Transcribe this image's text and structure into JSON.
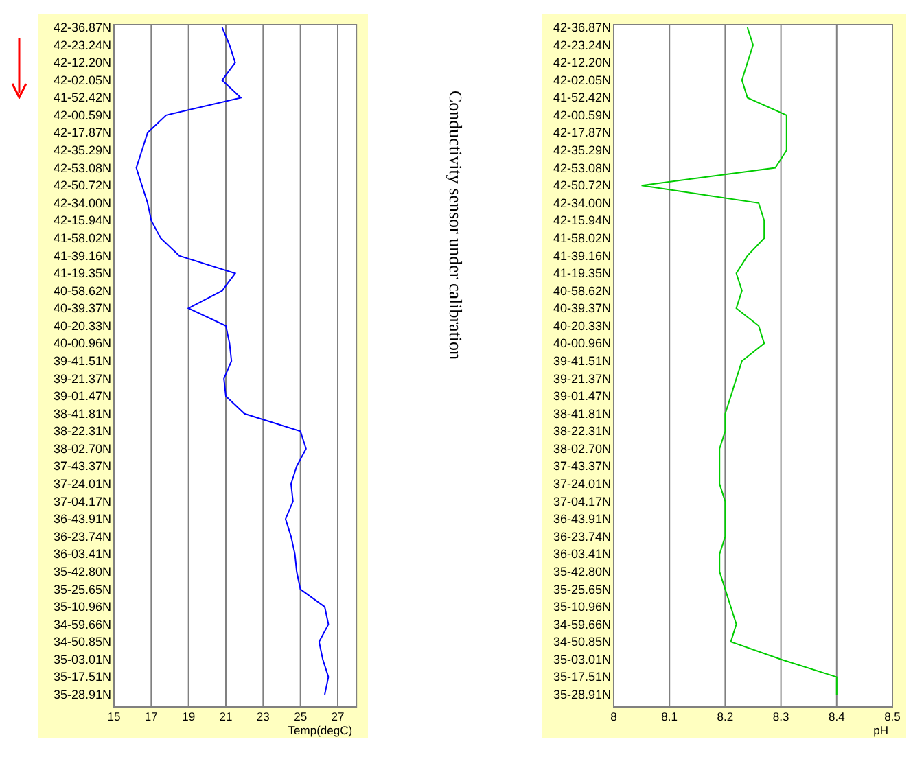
{
  "charts": [
    {
      "chart_data": {
        "type": "line",
        "orientation": "horizontal",
        "xlabel": "Temp(degC)",
        "grid": true,
        "xlim": [
          15,
          28
        ],
        "xticks": [
          15,
          17,
          19,
          21,
          23,
          25,
          27
        ],
        "categories": [
          "42-36.87N",
          "42-23.24N",
          "42-12.20N",
          "42-02.05N",
          "41-52.42N",
          "42-00.59N",
          "42-17.87N",
          "42-35.29N",
          "42-53.08N",
          "42-50.72N",
          "42-34.00N",
          "42-15.94N",
          "41-58.02N",
          "41-39.16N",
          "41-19.35N",
          "40-58.62N",
          "40-39.37N",
          "40-20.33N",
          "40-00.96N",
          "39-41.51N",
          "39-21.37N",
          "39-01.47N",
          "38-41.81N",
          "38-22.31N",
          "38-02.70N",
          "37-43.37N",
          "37-24.01N",
          "37-04.17N",
          "36-43.91N",
          "36-23.74N",
          "36-03.41N",
          "35-42.80N",
          "35-25.65N",
          "35-10.96N",
          "34-59.66N",
          "34-50.85N",
          "35-03.01N",
          "35-17.51N",
          "35-28.91N"
        ],
        "series": [
          {
            "color": "#0000ff",
            "values": [
              20.8,
              21.2,
              21.5,
              20.8,
              21.8,
              17.8,
              16.8,
              16.5,
              16.2,
              16.5,
              16.8,
              17.0,
              17.5,
              18.5,
              21.5,
              20.8,
              19.0,
              21.0,
              21.2,
              21.3,
              20.9,
              21.0,
              22.0,
              25.0,
              25.3,
              24.8,
              24.5,
              24.6,
              24.2,
              24.5,
              24.7,
              24.8,
              25.0,
              26.3,
              26.5,
              26.0,
              26.2,
              26.5,
              26.3
            ]
          }
        ]
      }
    },
    {
      "chart_data": {
        "type": "line",
        "orientation": "horizontal",
        "xlabel": "pH",
        "grid": true,
        "xlim": [
          8,
          8.5
        ],
        "xticks": [
          8,
          8.1,
          8.2,
          8.3,
          8.4,
          8.5
        ],
        "categories": [
          "42-36.87N",
          "42-23.24N",
          "42-12.20N",
          "42-02.05N",
          "41-52.42N",
          "42-00.59N",
          "42-17.87N",
          "42-35.29N",
          "42-53.08N",
          "42-50.72N",
          "42-34.00N",
          "42-15.94N",
          "41-58.02N",
          "41-39.16N",
          "41-19.35N",
          "40-58.62N",
          "40-39.37N",
          "40-20.33N",
          "40-00.96N",
          "39-41.51N",
          "39-21.37N",
          "39-01.47N",
          "38-41.81N",
          "38-22.31N",
          "38-02.70N",
          "37-43.37N",
          "37-24.01N",
          "37-04.17N",
          "36-43.91N",
          "36-23.74N",
          "36-03.41N",
          "35-42.80N",
          "35-25.65N",
          "35-10.96N",
          "34-59.66N",
          "34-50.85N",
          "35-03.01N",
          "35-17.51N",
          "35-28.91N"
        ],
        "series": [
          {
            "color": "#00cc00",
            "values": [
              8.24,
              8.25,
              8.24,
              8.23,
              8.24,
              8.31,
              8.31,
              8.31,
              8.29,
              8.05,
              8.26,
              8.27,
              8.27,
              8.24,
              8.22,
              8.23,
              8.22,
              8.26,
              8.27,
              8.23,
              8.22,
              8.21,
              8.2,
              8.2,
              8.19,
              8.19,
              8.19,
              8.2,
              8.2,
              8.2,
              8.19,
              8.19,
              8.2,
              8.21,
              8.22,
              8.21,
              8.3,
              8.4,
              8.4
            ]
          }
        ]
      }
    }
  ],
  "caption": "Conductivity sensor under calibration"
}
